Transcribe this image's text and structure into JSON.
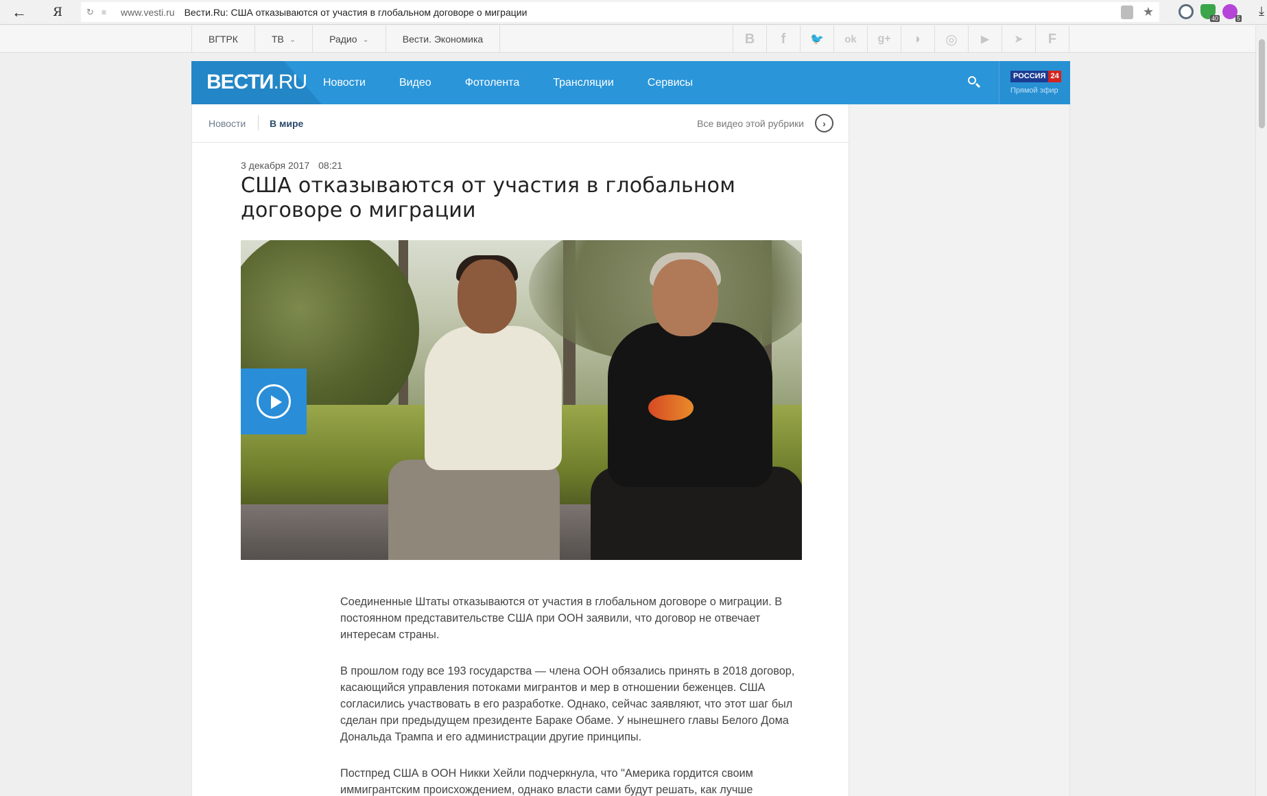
{
  "browser": {
    "back_glyph": "←",
    "yandex_glyph": "Я",
    "reload_glyph": "↻",
    "lines_glyph": "≡",
    "domain": "www.vesti.ru",
    "page_title": "Вести.Ru: США отказываются от участия в глобальном договоре о миграции",
    "star_glyph": "★",
    "download_glyph": "⤓",
    "extensions": [
      {
        "icon": "alice-icon",
        "badge": "",
        "color": "#5b6c7b"
      },
      {
        "icon": "shield-icon",
        "badge": "40",
        "color": "#3ba54a"
      },
      {
        "icon": "extension-icon",
        "badge": "5",
        "color": "#b545d8"
      }
    ]
  },
  "topbar": {
    "items": [
      {
        "label": "ВГТРК",
        "dropdown": false
      },
      {
        "label": "ТВ",
        "dropdown": true
      },
      {
        "label": "Радио",
        "dropdown": true
      },
      {
        "label": "Вести. Экономика",
        "dropdown": false
      }
    ],
    "chevron_glyph": "⌄",
    "social": [
      {
        "name": "vk-icon",
        "glyph": "B"
      },
      {
        "name": "facebook-icon",
        "glyph": "f"
      },
      {
        "name": "twitter-icon",
        "glyph": "🐦"
      },
      {
        "name": "odnoklassniki-icon",
        "glyph": "ok"
      },
      {
        "name": "google-plus-icon",
        "glyph": "g+"
      },
      {
        "name": "rss-icon",
        "glyph": "◗"
      },
      {
        "name": "instagram-icon",
        "glyph": "◎"
      },
      {
        "name": "youtube-icon",
        "glyph": "▶"
      },
      {
        "name": "telegram-icon",
        "glyph": "➤"
      },
      {
        "name": "flipboard-icon",
        "glyph": "F"
      }
    ]
  },
  "nav": {
    "logo_main": "ВЕСТИ",
    "logo_suffix": ".RU",
    "links": [
      "Новости",
      "Видео",
      "Фотолента",
      "Трансляции",
      "Сервисы"
    ],
    "russia24_name": "РОССИЯ",
    "russia24_num": "24",
    "live_label": "Прямой эфир",
    "accent_color": "#2a95d9"
  },
  "subnav": {
    "crumb_parent": "Новости",
    "crumb_current": "В мире",
    "all_video": "Все видео этой рубрики",
    "arrow_glyph": "›"
  },
  "article": {
    "date": "3 декабря 2017",
    "time": "08:21",
    "headline": "США отказываются от участия в глобальном договоре о миграции",
    "paragraphs": [
      "Соединенные Штаты отказываются от участия в глобальном договоре о миграции. В постоянном представительстве США при ООН заявили, что договор не отвечает интересам страны.",
      "В прошлом году все 193 государства — члена ООН обязались принять в 2018 договор, касающийся управления потоками мигрантов и мер в отношении беженцев. США согласились участвовать в его разработке. Однако, сейчас заявляют, что этот шаг был сделан при предыдущем президенте Бараке Обаме. У нынешнего главы Белого Дома Дональда Трампа и его администрации другие принципы.",
      "Постпред США в ООН Никки Хейли подчеркнула, что \"Америка гордится своим иммигрантским происхождением, однако власти сами будут решать, как лучше"
    ]
  }
}
